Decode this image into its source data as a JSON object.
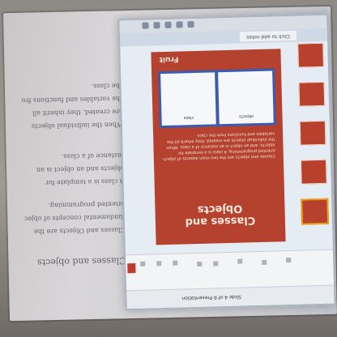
{
  "handwriting": {
    "title": "Classes and objects",
    "lines": [
      "Classes and Objects are the",
      "fundamental concepts of object",
      "oriented programming.",
      "A class is a template for",
      "objects and an object is an",
      "instance of a class.",
      "When the individual objects",
      "are created, they inherit all",
      "the variables and functions from",
      "the class."
    ]
  },
  "slide": {
    "title": "Classes and Objects",
    "bullets": "Classes and objects are the two main aspects of object-oriented programming. A class is a template for objects, and an object is an instance of a class. When the individual objects are created, they inherit all the variables and functions from the class.",
    "panel_left": "class",
    "panel_right": "objects",
    "header": "Fruit"
  },
  "window": {
    "tab": "Click to add notes",
    "status": "Slide 4 of 6  Presentation"
  },
  "colors": {
    "slide_red": "#b5412f",
    "panel_blue": "#3a5bb0",
    "accent": "#e8a21a"
  }
}
